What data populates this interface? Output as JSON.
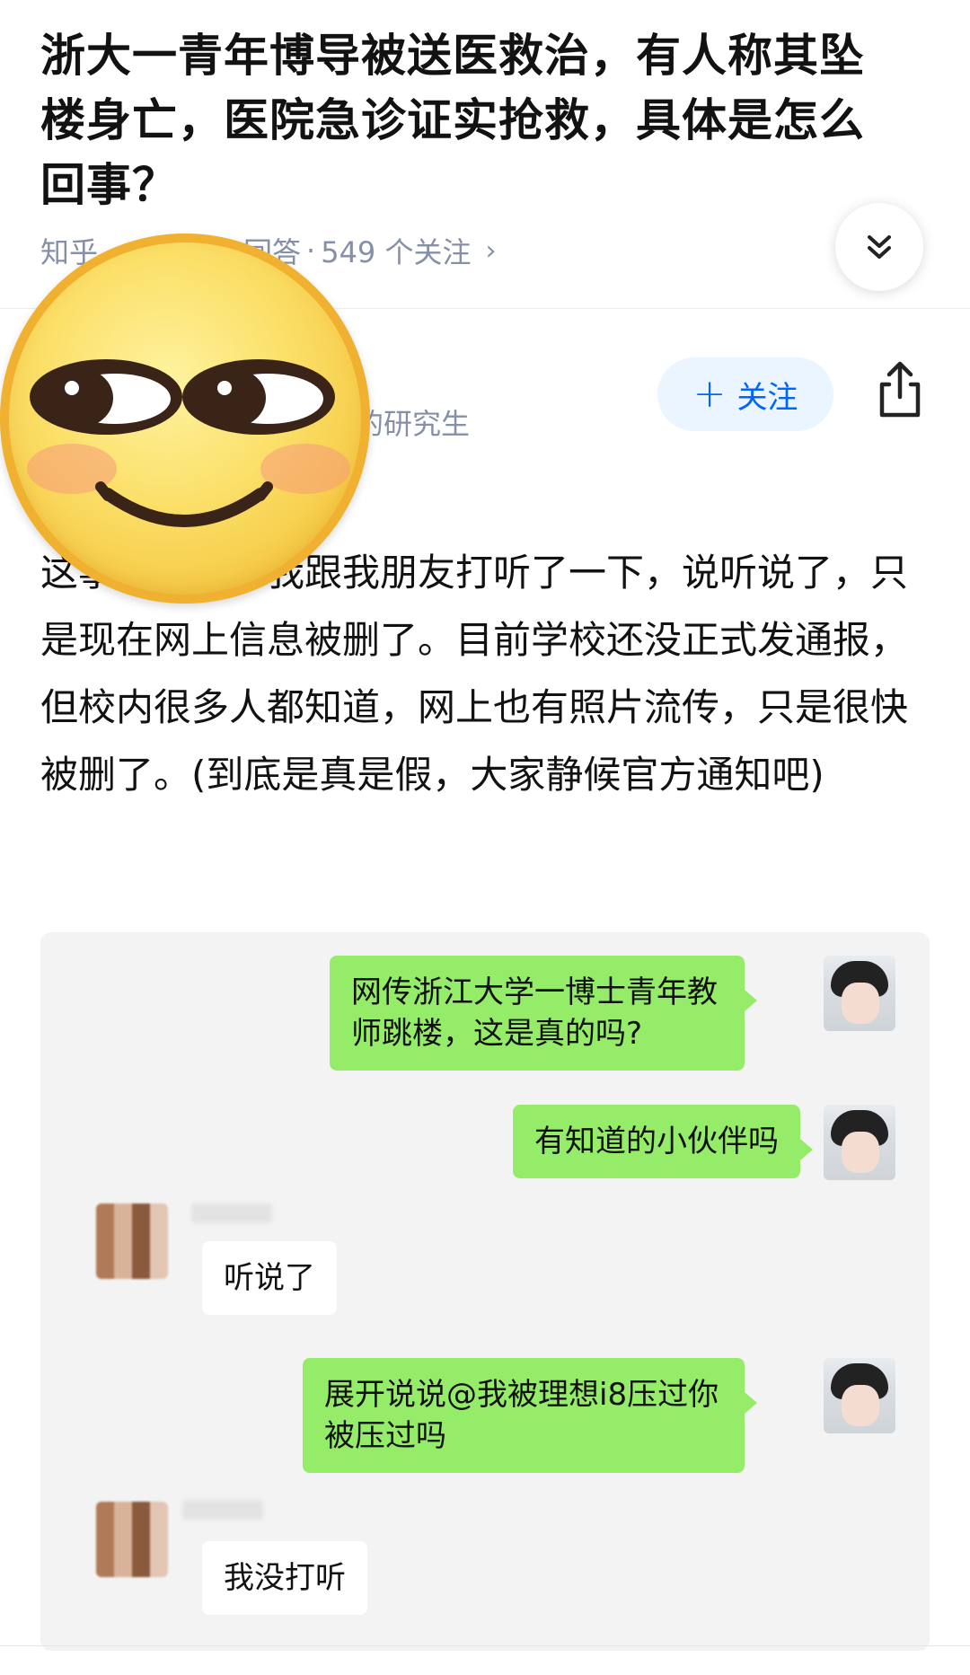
{
  "question": {
    "title": "浙大一青年博导被送医救治，有人称其坠楼身亡，医院急诊证实抢救，具体是怎么回事？",
    "meta_prefix": "知乎",
    "meta_answers": "回答",
    "meta_follows": "549 个关注"
  },
  "author": {
    "tail_text": "的研究生",
    "follow_label": "关注"
  },
  "answer": {
    "text": "这事是真的，我跟我朋友打听了一下，说听说了，只是现在网上信息被删了。目前学校还没正式发通报，但校内很多人都知道，网上也有照片流传，只是很快被删了。(到底是真是假，大家静候官方通知吧)"
  },
  "chat": {
    "messages": [
      {
        "side": "me",
        "text": "网传浙江大学一博士青年教师跳楼，这是真的吗?"
      },
      {
        "side": "me",
        "text": "有知道的小伙伴吗"
      },
      {
        "side": "them",
        "text": "听说了"
      },
      {
        "side": "me",
        "text": "展开说说@我被理想i8压过你被压过吗"
      },
      {
        "side": "them",
        "text": "我没打听"
      }
    ]
  },
  "icons": {
    "collapse": "double-chevron-down-icon",
    "share": "share-icon",
    "sticker": "smiling-emoji-sticker"
  },
  "colors": {
    "accent": "#0066ff",
    "follow_bg": "#ebf5ff",
    "meta": "#8590a6",
    "bubble_me": "#95ec69"
  }
}
